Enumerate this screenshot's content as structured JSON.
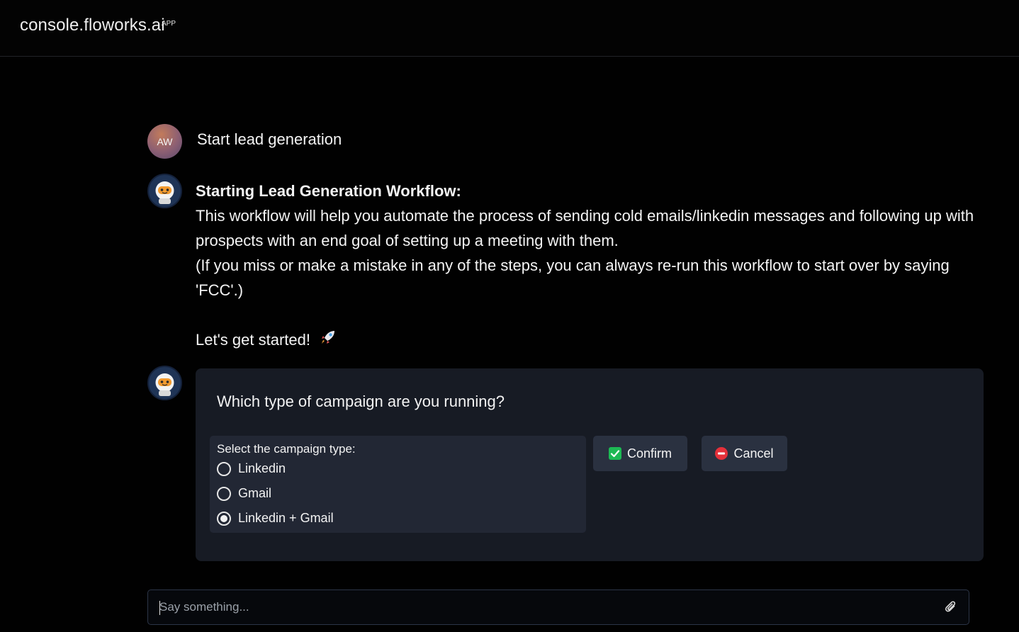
{
  "header": {
    "brand": "console.floworks.ai",
    "brand_tag": "APP"
  },
  "conversation": {
    "user_avatar_initials": "AW",
    "user_message": "Start lead generation",
    "bot_message": {
      "title": "Starting Lead Generation Workflow:",
      "paragraph_1": "This workflow will help you automate the process of sending cold emails/linkedin messages and following up with prospects with an end goal of setting up a meeting with them.",
      "paragraph_2": "(If you miss or make a mistake in any of the steps, you can always re-run this workflow to start over by saying 'FCC'.)",
      "closing": "Let's get started!",
      "closing_icon": "rocket-icon"
    },
    "bot_avatar_icon": "astronaut-icon"
  },
  "campaign_card": {
    "question": "Which type of campaign are you running?",
    "select_title": "Select the campaign type:",
    "options": [
      {
        "label": "Linkedin",
        "selected": false
      },
      {
        "label": "Gmail",
        "selected": false
      },
      {
        "label": "Linkedin + Gmail",
        "selected": true
      }
    ],
    "confirm_label": "Confirm",
    "confirm_icon": "checkbox-check-icon",
    "cancel_label": "Cancel",
    "cancel_icon": "no-entry-icon"
  },
  "composer": {
    "placeholder": "Say something...",
    "value": "",
    "attach_icon": "paperclip-icon"
  },
  "colors": {
    "background": "#010101",
    "card": "#171b24",
    "option_panel": "#222734",
    "button": "#2a3140",
    "confirm_green": "#1db954",
    "cancel_red": "#e5303a"
  }
}
